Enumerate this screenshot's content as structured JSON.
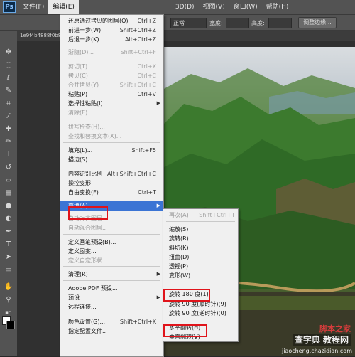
{
  "menubar": {
    "logo": "Ps",
    "items": [
      "文件(F)",
      "编辑(E)",
      "",
      "",
      "",
      "3D(D)",
      "视图(V)",
      "窗口(W)",
      "帮助(H)"
    ]
  },
  "options": {
    "mode_value": "正常",
    "opacity_label": "宽度:",
    "height_label": "高度:",
    "adjust_button": "调整边缘..."
  },
  "document": {
    "tab": "1e9f4b4888f0b8d2b4..."
  },
  "edit_menu": {
    "items": [
      {
        "label": "还原通过拷贝的图层(O)",
        "shortcut": "Ctrl+Z",
        "disabled": false
      },
      {
        "label": "前进一步(W)",
        "shortcut": "Shift+Ctrl+Z",
        "disabled": false
      },
      {
        "label": "后退一步(K)",
        "shortcut": "Alt+Ctrl+Z",
        "disabled": false
      },
      {
        "label": "渐隐(D)...",
        "shortcut": "Shift+Ctrl+F",
        "disabled": true
      },
      {
        "label": "剪切(T)",
        "shortcut": "Ctrl+X",
        "disabled": true
      },
      {
        "label": "拷贝(C)",
        "shortcut": "Ctrl+C",
        "disabled": true
      },
      {
        "label": "合并拷贝(Y)",
        "shortcut": "Shift+Ctrl+C",
        "disabled": true
      },
      {
        "label": "粘贴(P)",
        "shortcut": "Ctrl+V",
        "disabled": false
      },
      {
        "label": "选择性粘贴(I)",
        "shortcut": "",
        "disabled": false,
        "submenu": true
      },
      {
        "label": "清除(E)",
        "shortcut": "",
        "disabled": true
      },
      {
        "label": "拼写检查(H)...",
        "shortcut": "",
        "disabled": true
      },
      {
        "label": "查找和替换文本(X)...",
        "shortcut": "",
        "disabled": true
      },
      {
        "label": "填充(L)...",
        "shortcut": "Shift+F5",
        "disabled": false
      },
      {
        "label": "描边(S)...",
        "shortcut": "",
        "disabled": false
      },
      {
        "label": "内容识别比例",
        "shortcut": "Alt+Shift+Ctrl+C",
        "disabled": false
      },
      {
        "label": "操控变形",
        "shortcut": "",
        "disabled": false
      },
      {
        "label": "自由变换(F)",
        "shortcut": "Ctrl+T",
        "disabled": false
      },
      {
        "label": "变换(A)",
        "shortcut": "",
        "disabled": false,
        "submenu": true,
        "highlighted": true
      },
      {
        "label": "自动对齐图层...",
        "shortcut": "",
        "disabled": true
      },
      {
        "label": "自动混合图层...",
        "shortcut": "",
        "disabled": true
      },
      {
        "label": "定义画笔预设(B)...",
        "shortcut": "",
        "disabled": false
      },
      {
        "label": "定义图案...",
        "shortcut": "",
        "disabled": false
      },
      {
        "label": "定义自定形状...",
        "shortcut": "",
        "disabled": true
      },
      {
        "label": "清理(R)",
        "shortcut": "",
        "disabled": false,
        "submenu": true
      },
      {
        "label": "Adobe PDF 预设...",
        "shortcut": "",
        "disabled": false
      },
      {
        "label": "预设",
        "shortcut": "",
        "disabled": false,
        "submenu": true
      },
      {
        "label": "远程连接...",
        "shortcut": "",
        "disabled": false
      },
      {
        "label": "颜色设置(G)...",
        "shortcut": "Shift+Ctrl+K",
        "disabled": false
      },
      {
        "label": "指定配置文件...",
        "shortcut": "",
        "disabled": false
      }
    ]
  },
  "transform_menu": {
    "items": [
      {
        "label": "再次(A)",
        "shortcut": "Shift+Ctrl+T",
        "disabled": true
      },
      {
        "label": "缩放(S)",
        "shortcut": ""
      },
      {
        "label": "旋转(R)",
        "shortcut": ""
      },
      {
        "label": "斜切(K)",
        "shortcut": ""
      },
      {
        "label": "扭曲(D)",
        "shortcut": ""
      },
      {
        "label": "透视(P)",
        "shortcut": ""
      },
      {
        "label": "变形(W)",
        "shortcut": ""
      },
      {
        "label": "旋转 180 度(1)",
        "shortcut": ""
      },
      {
        "label": "旋转 90 度(顺时针)(9)",
        "shortcut": ""
      },
      {
        "label": "旋转 90 度(逆时针)(0)",
        "shortcut": ""
      },
      {
        "label": "水平翻转(H)",
        "shortcut": ""
      },
      {
        "label": "垂直翻转(V)",
        "shortcut": ""
      }
    ]
  },
  "watermark": {
    "line1": "脚本之家",
    "line2": "查字典 教程网",
    "line3": "jiaocheng.chazidian.com"
  },
  "colors": {
    "highlight": "#3b74d4",
    "annotation_red": "#e0141b"
  }
}
